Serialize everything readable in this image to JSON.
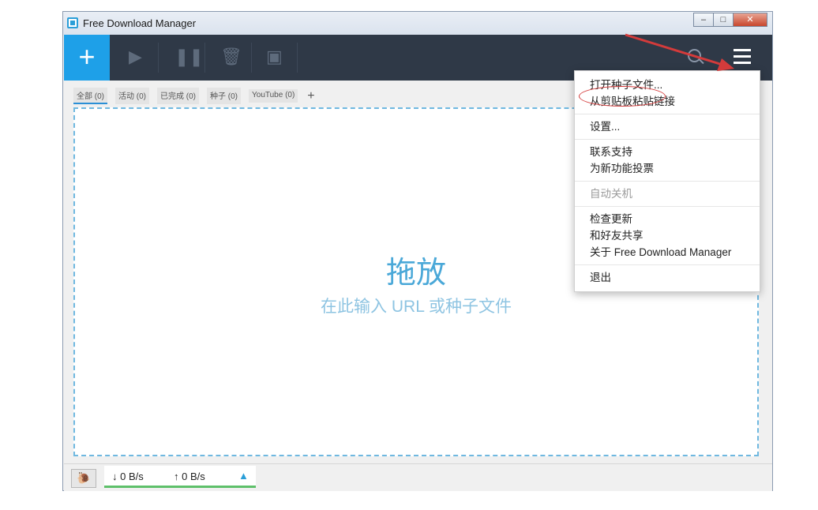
{
  "window": {
    "title": "Free Download Manager",
    "controls": [
      "‒",
      "□",
      "✕"
    ]
  },
  "toolbar": {
    "add_label": "+"
  },
  "tabs": [
    {
      "label": "全部 (0)"
    },
    {
      "label": "活动 (0)"
    },
    {
      "label": "已完成 (0)"
    },
    {
      "label": "种子 (0)"
    },
    {
      "label": "YouTube (0)"
    }
  ],
  "tab_add": "+",
  "dropzone": {
    "title": "拖放",
    "subtitle": "在此输入 URL 或种子文件"
  },
  "status": {
    "down": "↓ 0 B/s",
    "up": "↑ 0 B/s"
  },
  "menu": {
    "groups": [
      [
        {
          "label": "打开种子文件..."
        },
        {
          "label": "从剪贴板粘贴链接"
        }
      ],
      [
        {
          "label": "设置..."
        }
      ],
      [
        {
          "label": "联系支持"
        },
        {
          "label": "为新功能投票"
        }
      ],
      [
        {
          "label": "自动关机",
          "disabled": true
        }
      ],
      [
        {
          "label": "检查更新"
        },
        {
          "label": "和好友共享"
        },
        {
          "label": "关于 Free Download Manager"
        }
      ],
      [
        {
          "label": "退出"
        }
      ]
    ]
  },
  "colors": {
    "accent": "#1ea0e8",
    "toolbar": "#2f3947",
    "annotation": "#d43b3b"
  },
  "icons": [
    "app-icon",
    "plus-icon",
    "play-icon",
    "pause-icon",
    "trash-icon",
    "move-icon",
    "search-icon",
    "hamburger-menu-icon",
    "snail-icon",
    "chevron-up-icon"
  ]
}
